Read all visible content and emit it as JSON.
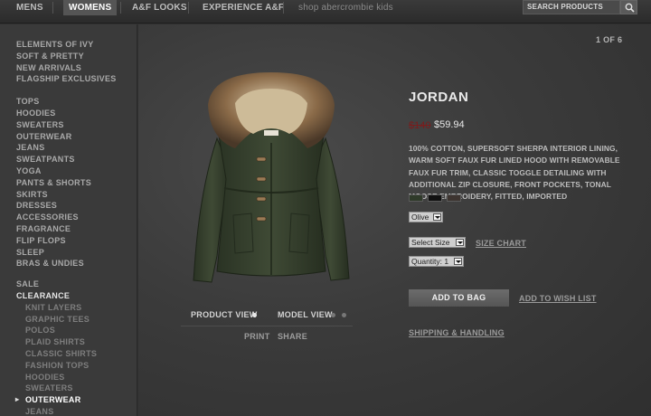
{
  "topnav": {
    "tabs": [
      {
        "label": "Mens"
      },
      {
        "label": "Womens",
        "active": true
      },
      {
        "label": "A&F Looks"
      },
      {
        "label": "Experience A&F"
      },
      {
        "label": "shop abercrombie kids"
      }
    ],
    "search_placeholder": "Search Products",
    "search_icon": "search-icon"
  },
  "sidebar": {
    "group1": [
      "Elements of Ivy",
      "Soft & Pretty",
      "New Arrivals",
      "Flagship Exclusives"
    ],
    "group2": [
      "Tops",
      "Hoodies",
      "Sweaters",
      "Outerwear",
      "Jeans",
      "Sweatpants",
      "Yoga",
      "Pants & Shorts",
      "Skirts",
      "Dresses",
      "Accessories",
      "Fragrance",
      "Flip Flops",
      "Sleep",
      "Bras & Undies"
    ],
    "group3": [
      "Sale",
      "Clearance"
    ],
    "clearance_items": [
      "Knit Layers",
      "Graphic Tees",
      "Polos",
      "Plaid Shirts",
      "Classic Shirts",
      "Fashion Tops",
      "Hoodies",
      "Sweaters",
      "Outerwear",
      "Jeans"
    ],
    "active_item": "Outerwear"
  },
  "pager": {
    "text": "1 OF 6"
  },
  "product": {
    "title": "Jordan",
    "old_price": "$140",
    "price": "$59.94",
    "description": "100% cotton, supersoft sherpa interior lining, warm soft faux fur lined hood with removable faux fur trim, classic toggle detailing with additional zip closure, front pockets, tonal moose embroidery, fitted, imported",
    "swatches": [
      "#2f3a2a",
      "#111111",
      "#3d3430"
    ],
    "color_select": "Olive",
    "size_select": "Select Size",
    "size_chart": "Size Chart",
    "quantity_select": "Quantity: 1",
    "add_to_bag": "Add to Bag",
    "add_to_wishlist": "Add to Wish List",
    "shipping": "Shipping & Handling"
  },
  "views": {
    "product_view": "Product View",
    "model_view": "Model View",
    "print": "Print",
    "share": "Share"
  }
}
